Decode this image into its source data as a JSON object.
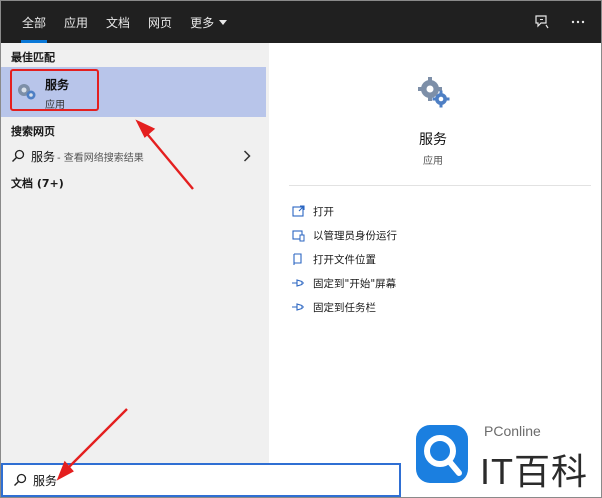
{
  "tabs": [
    {
      "label": "全部",
      "active": true
    },
    {
      "label": "应用"
    },
    {
      "label": "文档"
    },
    {
      "label": "网页"
    },
    {
      "label": "更多"
    }
  ],
  "left": {
    "best_match_title": "最佳匹配",
    "best_match": {
      "name": "服务",
      "type": "应用"
    },
    "search_web_title": "搜索网页",
    "web_result": {
      "term": "服务",
      "hint": " - 查看网络搜索结果"
    },
    "documents_title": "文档 (7+)"
  },
  "right": {
    "title": "服务",
    "subtitle": "应用",
    "actions": [
      {
        "label": "打开",
        "icon": "open-window-icon"
      },
      {
        "label": "以管理员身份运行",
        "icon": "shield-admin-icon"
      },
      {
        "label": "打开文件位置",
        "icon": "file-location-icon"
      },
      {
        "label": "固定到\"开始\"屏幕",
        "icon": "pin-icon"
      },
      {
        "label": "固定到任务栏",
        "icon": "pin-icon"
      }
    ]
  },
  "search": {
    "value": "服务"
  },
  "watermark": {
    "brand": "PConline",
    "name": "IT百科"
  },
  "colors": {
    "topbar": "#202020",
    "accent": "#0a78d7",
    "selection": "#b8c5ea",
    "annotation_red": "#e41f1f"
  }
}
